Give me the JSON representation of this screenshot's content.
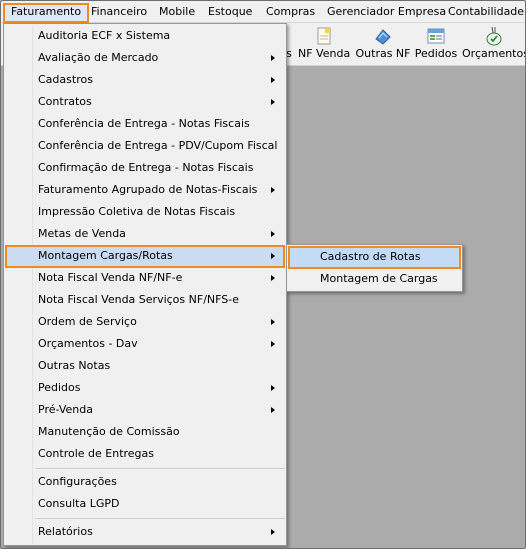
{
  "menubar": {
    "items": [
      {
        "label": "Faturamento",
        "active": true
      },
      {
        "label": "Financeiro"
      },
      {
        "label": "Mobile"
      },
      {
        "label": "Estoque"
      },
      {
        "label": "Compras"
      },
      {
        "label": "Gerenciador Empresa"
      },
      {
        "label": "Contabilidade"
      }
    ]
  },
  "toolbar": {
    "partial_label": "s",
    "buttons": [
      {
        "label": "NF Venda",
        "icon": "nf-venda-icon"
      },
      {
        "label": "Outras NF",
        "icon": "outras-nf-icon"
      },
      {
        "label": "Pedidos",
        "icon": "pedidos-icon"
      },
      {
        "label": "Orçamentos",
        "icon": "orcamentos-icon"
      }
    ]
  },
  "dropdown": {
    "items": [
      {
        "label": "Auditoria ECF x Sistema",
        "submenu": false
      },
      {
        "label": "Avaliação de Mercado",
        "submenu": true
      },
      {
        "label": "Cadastros",
        "submenu": true
      },
      {
        "label": "Contratos",
        "submenu": true
      },
      {
        "label": "Conferência de Entrega - Notas Fiscais",
        "submenu": false
      },
      {
        "label": "Conferência de Entrega - PDV/Cupom Fiscal",
        "submenu": false
      },
      {
        "label": "Confirmação de Entrega - Notas Fiscais",
        "submenu": false
      },
      {
        "label": "Faturamento Agrupado de Notas-Fiscais",
        "submenu": true
      },
      {
        "label": "Impressão Coletiva de Notas Fiscais",
        "submenu": false
      },
      {
        "label": "Metas de Venda",
        "submenu": true
      },
      {
        "label": "Montagem Cargas/Rotas",
        "submenu": true,
        "highlighted": true
      },
      {
        "label": "Nota Fiscal Venda NF/NF-e",
        "submenu": true
      },
      {
        "label": "Nota Fiscal Venda Serviços NF/NFS-e",
        "submenu": false
      },
      {
        "label": "Ordem de Serviço",
        "submenu": true
      },
      {
        "label": "Orçamentos - Dav",
        "submenu": true
      },
      {
        "label": "Outras Notas",
        "submenu": false
      },
      {
        "label": "Pedidos",
        "submenu": true
      },
      {
        "label": "Pré-Venda",
        "submenu": true
      },
      {
        "label": "Manutenção de Comissão",
        "submenu": false
      },
      {
        "label": "Controle de Entregas",
        "submenu": false
      },
      {
        "label": "Configurações",
        "submenu": false
      },
      {
        "label": "Consulta LGPD",
        "submenu": false
      },
      {
        "label": "Relatórios",
        "submenu": true
      }
    ]
  },
  "submenu": {
    "items": [
      {
        "label": "Cadastro de Rotas",
        "highlighted": true
      },
      {
        "label": "Montagem de Cargas"
      }
    ]
  },
  "colors": {
    "highlight_border": "#f28a1e",
    "highlight_fill": "#cbdcf2",
    "workspace": "#ababab",
    "menu_bg": "#f0f0f0"
  }
}
